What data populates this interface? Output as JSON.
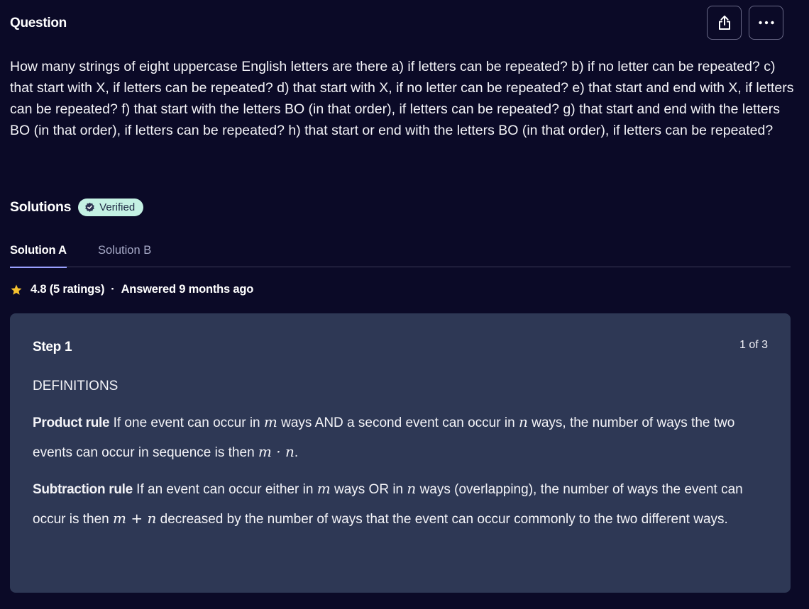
{
  "header": {
    "title": "Question",
    "share_icon": "share-icon",
    "more_icon": "more-horizontal-icon"
  },
  "question": {
    "text": "How many strings of eight uppercase English letters are there a) if letters can be repeated? b) if no letter can be repeated? c) that start with X, if letters can be repeated? d) that start with X, if no letter can be repeated? e) that start and end with X, if letters can be repeated? f) that start with the letters BO (in that order), if letters can be repeated? g) that start and end with the letters BO (in that order), if letters can be repeated? h) that start or end with the letters BO (in that order), if letters can be repeated?"
  },
  "solutions": {
    "title": "Solutions",
    "badge": "Verified",
    "badge_icon": "verified-check-icon",
    "tabs": [
      {
        "label": "Solution A",
        "active": true
      },
      {
        "label": "Solution B",
        "active": false
      }
    ],
    "rating": "4.8 (5 ratings)",
    "rating_separator": "·",
    "answered": "Answered 9 months ago",
    "star_color": "#f5c12e"
  },
  "step": {
    "title": "Step 1",
    "counter": "1 of 3",
    "heading": "DEFINITIONS",
    "product": {
      "term": "Product rule",
      "text_1": "If one event can occur in",
      "var_m": "m",
      "text_2": "ways AND a second event can occur in",
      "var_n": "n",
      "text_3": "ways, the number of ways the two events can occur in sequence is then",
      "formula": "m · n",
      "text_4": "."
    },
    "subtraction": {
      "term": "Subtraction rule",
      "text_1": "If an event can occur either in",
      "var_m": "m",
      "text_2": "ways OR in",
      "var_n": "n",
      "text_3": "ways (overlapping), the number of ways the event can occur is then",
      "formula": "m + n",
      "text_4": "decreased by the number of ways that the event can occur commonly to the two different ways."
    }
  },
  "colors": {
    "background": "#0b0a27",
    "card": "#2e3855",
    "badge_bg": "#c4f1e3",
    "tab_underline": "#9aa0ff"
  }
}
